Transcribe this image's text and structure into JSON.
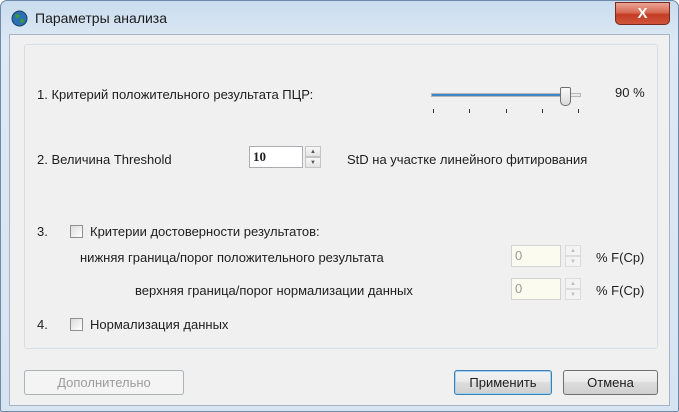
{
  "window": {
    "title": "Параметры анализа",
    "close_label": "X"
  },
  "criterion": {
    "label": "1. Критерий положительного результата ПЦР:",
    "value_text": "90 %",
    "level_fraction": 0.9
  },
  "threshold": {
    "label": "2. Величина Threshold",
    "value": "10",
    "suffix": "StD на участке линейного фитирования"
  },
  "reliability": {
    "number": "3.",
    "checkbox_label": "Критерии достоверности результатов:",
    "checked": false,
    "lower_label": "нижняя граница/порог положительного результата",
    "lower_value": "0",
    "lower_unit": "% F(Cp)",
    "upper_label": "верхняя граница/порог нормализации данных",
    "upper_value": "0",
    "upper_unit": "% F(Cp)"
  },
  "normalization": {
    "number": "4.",
    "checkbox_label": "Нормализация данных",
    "checked": false
  },
  "buttons": {
    "advanced": "Дополнительно",
    "apply": "Применить",
    "cancel": "Отмена"
  },
  "colors": {
    "slider_fill": "#3d86c7",
    "close_button": "#c33d24"
  }
}
